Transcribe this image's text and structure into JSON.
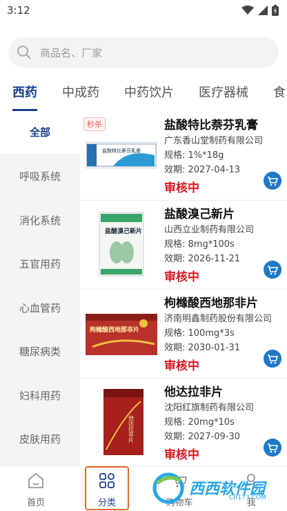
{
  "status_bar": {
    "time": "3:12"
  },
  "search": {
    "placeholder": "商品名、厂家"
  },
  "tabs": [
    {
      "label": "西药",
      "active": true
    },
    {
      "label": "中成药",
      "active": false
    },
    {
      "label": "中药饮片",
      "active": false
    },
    {
      "label": "医疗器械",
      "active": false
    },
    {
      "label": "食",
      "active": false
    }
  ],
  "sidebar": {
    "items": [
      {
        "label": "全部",
        "active": true
      },
      {
        "label": "呼吸系统",
        "active": false
      },
      {
        "label": "消化系统",
        "active": false
      },
      {
        "label": "五官用药",
        "active": false
      },
      {
        "label": "心血管药",
        "active": false
      },
      {
        "label": "糖尿病类",
        "active": false
      },
      {
        "label": "妇科用药",
        "active": false
      },
      {
        "label": "皮肤用药",
        "active": false
      }
    ]
  },
  "products": [
    {
      "badge": "秒杀",
      "name": "盐酸特比萘芬乳膏",
      "manufacturer": "广东香山堂制药有限公司",
      "spec": "规格: 1%*18g",
      "expiry": "效期: 2027-04-13",
      "status": "审核中",
      "image_label": "盐酸特比萘芬乳膏"
    },
    {
      "badge": "",
      "name": "盐酸溴己新片",
      "manufacturer": "山西立业制药有限公司",
      "spec": "规格: 8mg*100s",
      "expiry": "效期: 2026-11-21",
      "status": "审核中",
      "image_label": "盐酸溴己新片"
    },
    {
      "badge": "",
      "name": "枸橼酸西地那非片",
      "manufacturer": "济南明鑫制药股份有限公司",
      "spec": "规格: 100mg*3s",
      "expiry": "效期: 2030-01-31",
      "status": "审核中",
      "image_label": "枸橼酸西地那非片"
    },
    {
      "badge": "",
      "name": "他达拉非片",
      "manufacturer": "沈阳红旗制药有限公司",
      "spec": "规格: 20mg*10s",
      "expiry": "效期: 2027-09-30",
      "status": "审核中",
      "image_label": "他达拉非片"
    }
  ],
  "bottom_nav": [
    {
      "label": "首页",
      "icon": "home-icon",
      "active": false
    },
    {
      "label": "分类",
      "icon": "category-icon",
      "active": true
    },
    {
      "label": "购物车",
      "icon": "cart-icon",
      "active": false
    },
    {
      "label": "我",
      "icon": "user-icon",
      "active": false
    }
  ],
  "watermark": {
    "title": "西西软件园",
    "subtitle": "CR173.COM"
  },
  "colors": {
    "accent": "#1a3f8f",
    "status_red": "#d71920",
    "cart_blue": "#1e78c8",
    "highlight_orange": "#e06b2a"
  }
}
